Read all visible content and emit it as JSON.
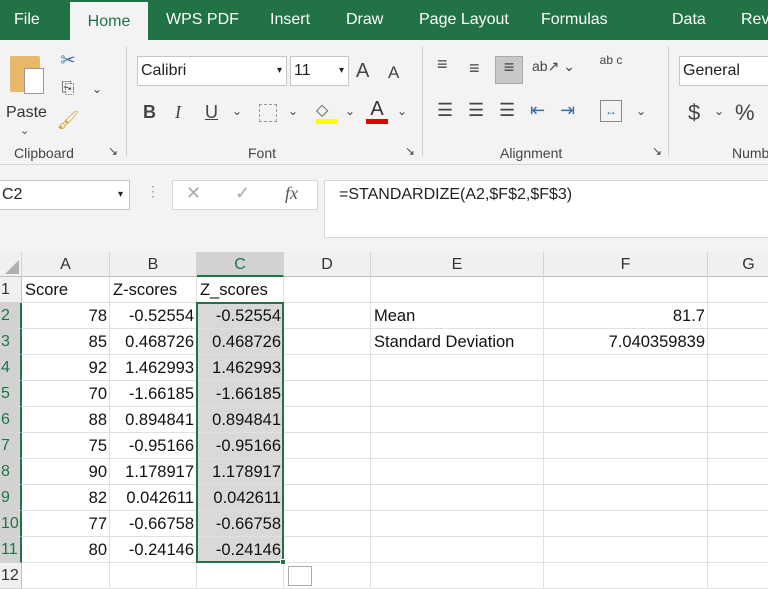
{
  "tabs": [
    "File",
    "Home",
    "WPS PDF",
    "Insert",
    "Draw",
    "Page Layout",
    "Formulas",
    "Data",
    "Review"
  ],
  "ribbon": {
    "clipboard": {
      "paste": "Paste",
      "label": "Clipboard"
    },
    "font": {
      "name": "Calibri",
      "size": "11",
      "label": "Font",
      "bold": "B",
      "italic": "I",
      "underline": "U",
      "grow": "A",
      "shrink": "A",
      "fontcolor": "A"
    },
    "alignment": {
      "label": "Alignment",
      "wrap": "ab c"
    },
    "number": {
      "format": "General",
      "currency": "$",
      "percent": "%",
      "label": "Numb"
    }
  },
  "namebox": "C2",
  "fx": "fx",
  "formula": "=STANDARDIZE(A2,$F$2,$F$3)",
  "columns": [
    "A",
    "B",
    "C",
    "D",
    "E",
    "F",
    "G"
  ],
  "rows": [
    "1",
    "2",
    "3",
    "4",
    "5",
    "6",
    "7",
    "8",
    "9",
    "10",
    "11",
    "12"
  ],
  "headers": {
    "a": "Score",
    "b": "Z-scores",
    "c": "Z_scores"
  },
  "data": [
    {
      "a": "78",
      "b": "-0.52554",
      "c": "-0.52554"
    },
    {
      "a": "85",
      "b": "0.468726",
      "c": "0.468726"
    },
    {
      "a": "92",
      "b": "1.462993",
      "c": "1.462993"
    },
    {
      "a": "70",
      "b": "-1.66185",
      "c": "-1.66185"
    },
    {
      "a": "88",
      "b": "0.894841",
      "c": "0.894841"
    },
    {
      "a": "75",
      "b": "-0.95166",
      "c": "-0.95166"
    },
    {
      "a": "90",
      "b": "1.178917",
      "c": "1.178917"
    },
    {
      "a": "82",
      "b": "0.042611",
      "c": "0.042611"
    },
    {
      "a": "77",
      "b": "-0.66758",
      "c": "-0.66758"
    },
    {
      "a": "80",
      "b": "-0.24146",
      "c": "-0.24146"
    }
  ],
  "stats": [
    {
      "label": "Mean",
      "value": "81.7"
    },
    {
      "label": "Standard Deviation",
      "value": "7.040359839"
    }
  ],
  "colors": {
    "accent": "#217346",
    "selection": "#d9d9d9"
  }
}
